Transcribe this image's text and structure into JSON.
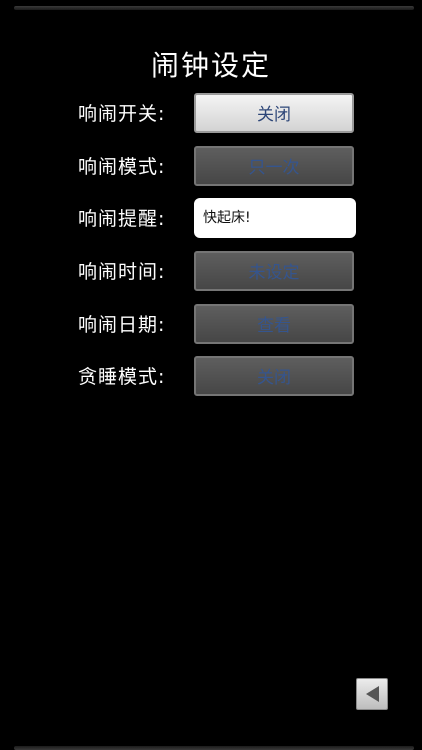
{
  "title": "闹钟设定",
  "rows": [
    {
      "label": "响闹开关:",
      "value": "关闭",
      "type": "button",
      "state": "active"
    },
    {
      "label": "响闹模式:",
      "value": "只一次",
      "type": "button",
      "state": "disabled"
    },
    {
      "label": "响闹提醒:",
      "value": "快起床!",
      "type": "input",
      "state": "active"
    },
    {
      "label": "响闹时间:",
      "value": "未设定",
      "type": "button",
      "state": "disabled"
    },
    {
      "label": "响闹日期:",
      "value": "查看",
      "type": "button",
      "state": "disabled"
    },
    {
      "label": "贪睡模式:",
      "value": "关闭",
      "type": "button",
      "state": "disabled"
    }
  ],
  "back_button": {
    "icon": "triangle-left-icon"
  },
  "colors": {
    "background": "#000000",
    "label_text": "#ffffff",
    "button_text": "#35558e",
    "active_button": "#e6e6e6",
    "disabled_button": "#555555"
  }
}
